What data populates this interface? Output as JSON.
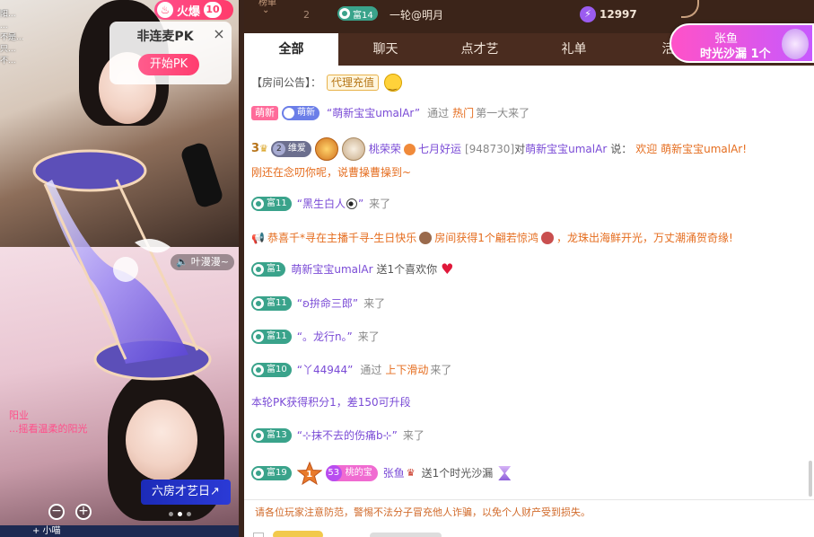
{
  "video": {
    "overlay_lines": [
      "阳...",
      "...",
      "不是...",
      "只...",
      "不..."
    ],
    "hot_label": "火爆",
    "hot_level": "10",
    "pk_card": {
      "title": "非连麦PK",
      "close": "×",
      "start": "开始PK"
    },
    "cam_name": "叶漫漫~",
    "pink_caption_1": "阳业",
    "pink_caption_2": "...摇看温柔的阳光",
    "room_button": "六房才艺日↗",
    "zoom_out": "−",
    "zoom_in": "+",
    "bottom_strip": "+ 小喵"
  },
  "top_rank": {
    "cut_text": "榜单",
    "chevron": "⌄",
    "rank": "2",
    "fu_label": "富14",
    "username": "一轮@明月",
    "coin_icon": "⚡",
    "coins": "12997"
  },
  "tabs": [
    {
      "label": "全部",
      "active": true
    },
    {
      "label": "聊天",
      "active": false
    },
    {
      "label": "点才艺",
      "active": false
    },
    {
      "label": "礼单",
      "active": false
    },
    {
      "label": "活",
      "active": false
    }
  ],
  "promo": {
    "name": "张鱼",
    "gift": "时光沙漏 1个"
  },
  "chat": {
    "announcement": {
      "label": "【房间公告】：",
      "tag": "代理充值"
    },
    "newbie_join": {
      "tag": "萌新",
      "badge": "萌新",
      "text": "“萌新宝宝umalAr”",
      "via": "通过",
      "via_source": "热门",
      "suffix": "第一大来了"
    },
    "gift_thanks": {
      "level": "3",
      "vip_num": "2",
      "vip_label": "维爱",
      "sender": "桃荣荣",
      "sender2": "七月好运",
      "room_id": "[948730]",
      "to": "对",
      "target": "萌新宝宝umalAr",
      "say": "说：",
      "line1": "欢迎 萌新宝宝umalAr!",
      "line2": "刚还在念叨你呢，说曹操曹操到~"
    },
    "join_heisheng": {
      "fu": "富11",
      "name": "“黑生白人",
      "end": "”",
      "suffix": "来了"
    },
    "broadcast": {
      "text_a": "恭喜千*寻在主播千寻-生日快乐",
      "text_b": "房间获得1个翩若惊鸿",
      "text_c": "，龙珠出海鲜开光，万丈潮涌贺奇缘!"
    },
    "gift_like": {
      "fu": "富1",
      "name": "萌新宝宝umalAr",
      "text": "送1个喜欢你"
    },
    "join_pinming": {
      "fu": "富11",
      "name": "“ʚ拚命三郎”",
      "suffix": "来了"
    },
    "join_longxing": {
      "fu": "富11",
      "name": "“。龙行n。”",
      "suffix": "来了"
    },
    "join_y44944": {
      "fu": "富10",
      "name": "“丫44944”",
      "via": "通过",
      "via_source": "上下滑动",
      "suffix": "来了"
    },
    "pk_score": {
      "text": "本轮PK获得积分1，差150可升段"
    },
    "join_shang": {
      "fu": "富13",
      "name": "“⊹抹不去的伤痛b⊹”",
      "suffix": "来了"
    },
    "gift_hourglass": {
      "fu": "富19",
      "rank": "1",
      "fan_num": "53",
      "fan_label": "桃的宝",
      "name": "张鱼",
      "text": "送1个时光沙漏"
    }
  },
  "warning": "请各位玩家注意防范，警惕不法分子冒充他人诈骗，以免个人财产受到损失。",
  "colors": {
    "fu_green": "#3aa38b",
    "tab_bar": "#4a2c1f",
    "accent_purple": "#7a4bd6",
    "accent_orange": "#e56d1f"
  }
}
